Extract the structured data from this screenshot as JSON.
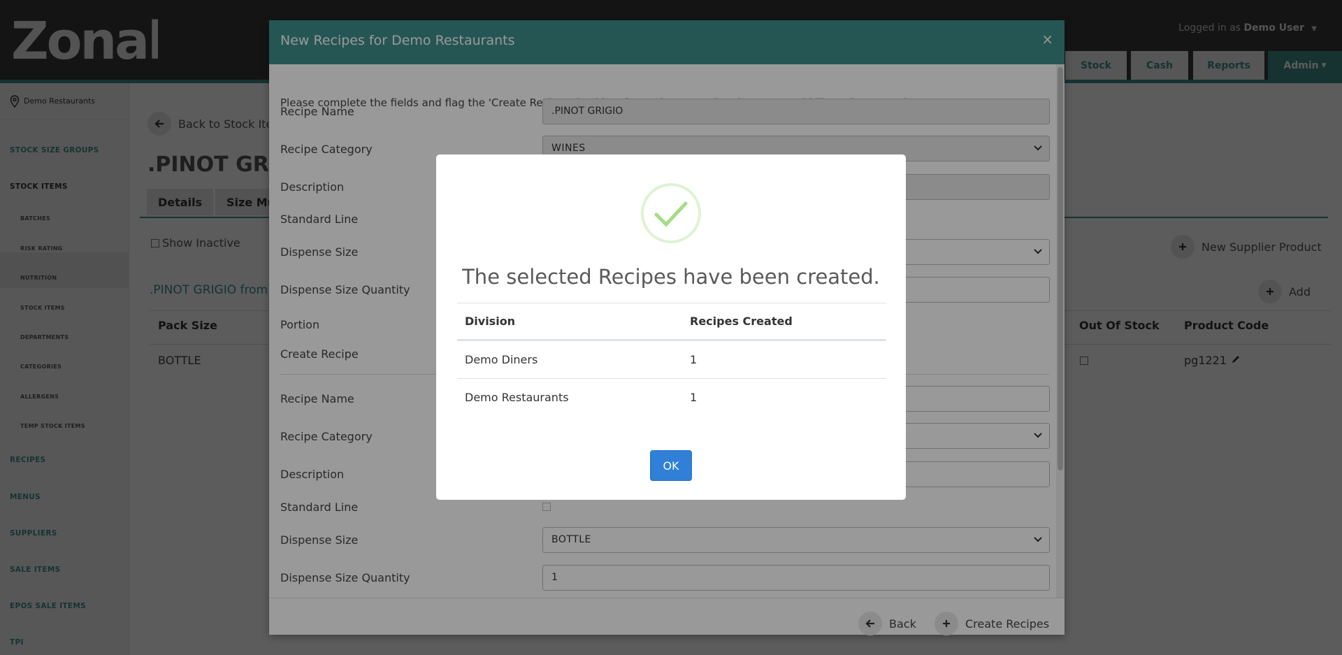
{
  "header": {
    "logo_text": "Zonal",
    "logged_in_prefix": "Logged in as",
    "logged_in_user": "Demo User",
    "nav": [
      "Stock",
      "Cash",
      "Reports",
      "Admin"
    ]
  },
  "sidebar": {
    "location": "Demo Restaurants",
    "items": [
      "STOCK SIZE GROUPS",
      "STOCK ITEMS",
      "BATCHES",
      "RISK RATING",
      "NUTRITION",
      "STOCK ITEMS",
      "DEPARTMENTS",
      "CATEGORIES",
      "ALLERGENS",
      "TEMP STOCK ITEMS",
      "RECIPES",
      "MENUS",
      "SUPPLIERS",
      "SALE ITEMS",
      "EPOS SALE ITEMS",
      "TPI"
    ]
  },
  "page": {
    "back_label": "Back to Stock Ite",
    "title": ".PINOT GRIG",
    "tabs": [
      "Details",
      "Size Mu"
    ],
    "show_inactive": "Show Inactive",
    "new_supplier_product": "New Supplier Product",
    "add_label": "Add",
    "section_title": ".PINOT GRIGIO from",
    "columns": [
      "Pack Size",
      "Out Of Stock",
      "Product Code"
    ],
    "row": {
      "pack_size": "BOTTLE",
      "product_code": "pg1221"
    }
  },
  "modal": {
    "title": "New Recipes for Demo Restaurants",
    "close": "×",
    "intro": "Please complete the fields and flag the 'Create Recipe' checkbox for each new Recipe that you would like to be created.",
    "labels": {
      "recipe_name": "Recipe Name",
      "recipe_category": "Recipe Category",
      "description": "Description",
      "standard_line": "Standard Line",
      "dispense_size": "Dispense Size",
      "dispense_size_quantity": "Dispense Size Quantity",
      "portion": "Portion",
      "create_recipe": "Create Recipe"
    },
    "values": {
      "recipe_name": ".PINOT GRIGIO",
      "recipe_category": "WINES",
      "dispense_size_2": "BOTTLE",
      "dispense_qty_2": "1"
    },
    "footer": {
      "back": "Back",
      "create": "Create Recipes"
    }
  },
  "dialog": {
    "title": "The selected Recipes have been created.",
    "columns": [
      "Division",
      "Recipes Created"
    ],
    "rows": [
      {
        "division": "Demo Diners",
        "count": "1"
      },
      {
        "division": "Demo Restaurants",
        "count": "1"
      }
    ],
    "ok": "OK"
  },
  "colors": {
    "teal": "#3f8f8c",
    "ok_blue": "#2f80d6",
    "success_green": "#a5dc86"
  }
}
